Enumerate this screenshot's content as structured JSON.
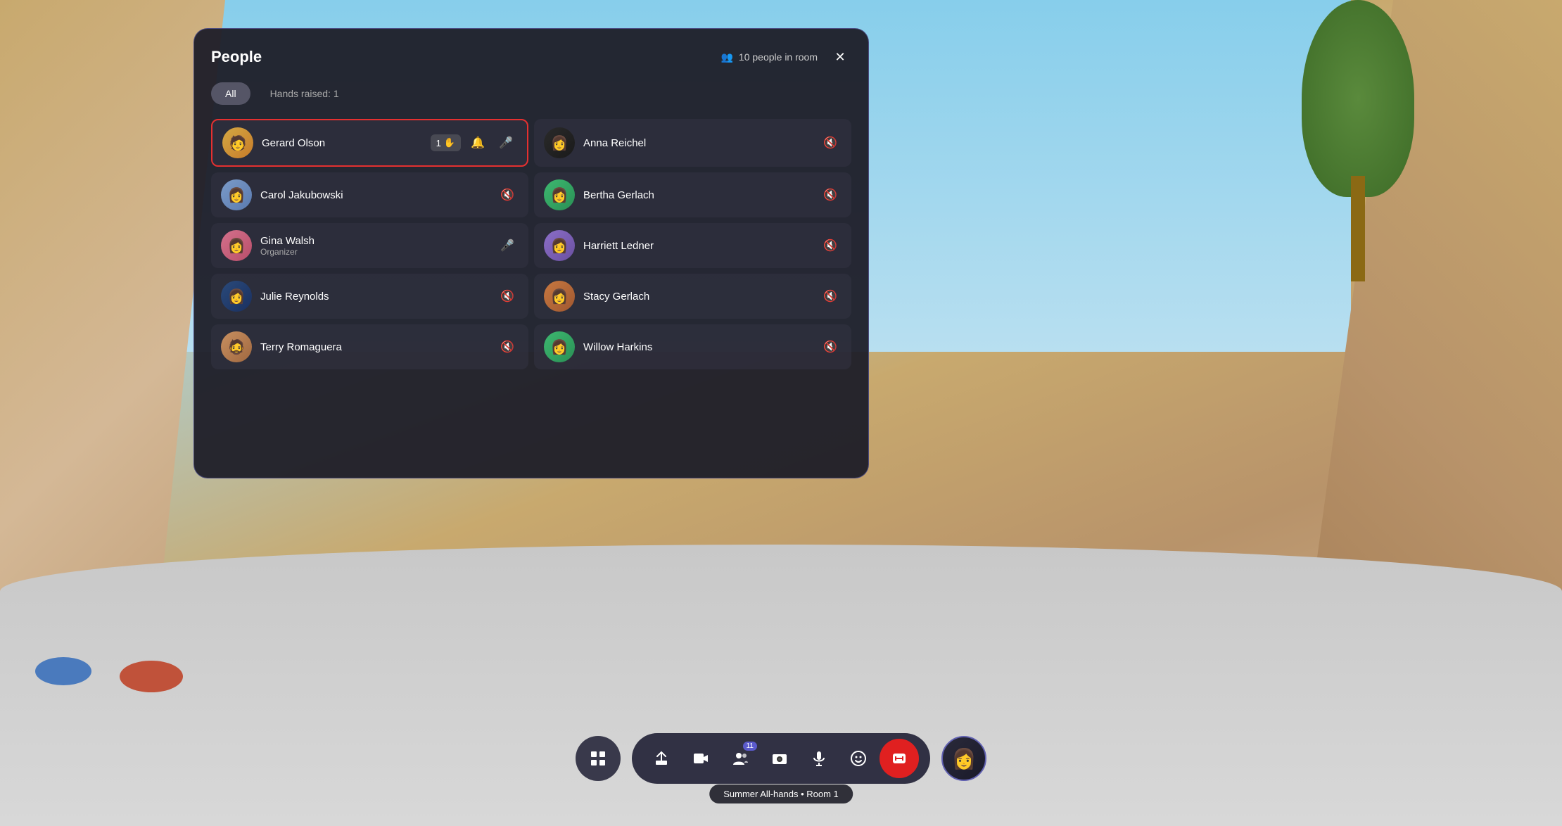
{
  "app": {
    "session_label": "Summer All-hands • Room 1"
  },
  "panel": {
    "title": "People",
    "people_count": "10 people in room",
    "tabs": [
      {
        "id": "all",
        "label": "All",
        "active": true
      },
      {
        "id": "hands",
        "label": "Hands raised: 1",
        "active": false
      }
    ],
    "people": [
      {
        "id": "gerard",
        "name": "Gerard Olson",
        "role": "",
        "hand_raised": true,
        "hand_count": "1",
        "mic_active": true,
        "mic_muted": false,
        "notification": true,
        "avatar_color": "gerard",
        "avatar_emoji": "🧑"
      },
      {
        "id": "anna",
        "name": "Anna Reichel",
        "role": "",
        "hand_raised": false,
        "mic_muted": true,
        "avatar_color": "anna",
        "avatar_emoji": "👩"
      },
      {
        "id": "carol",
        "name": "Carol Jakubowski",
        "role": "",
        "hand_raised": false,
        "mic_muted": true,
        "avatar_color": "carol",
        "avatar_emoji": "👩"
      },
      {
        "id": "bertha",
        "name": "Bertha Gerlach",
        "role": "",
        "hand_raised": false,
        "mic_muted": true,
        "avatar_color": "bertha",
        "avatar_emoji": "👩"
      },
      {
        "id": "gina",
        "name": "Gina Walsh",
        "role": "Organizer",
        "hand_raised": false,
        "mic_active": true,
        "mic_muted": false,
        "avatar_color": "gina",
        "avatar_emoji": "👩"
      },
      {
        "id": "harriett",
        "name": "Harriett Ledner",
        "role": "",
        "hand_raised": false,
        "mic_muted": true,
        "avatar_color": "harriett",
        "avatar_emoji": "👩"
      },
      {
        "id": "julie",
        "name": "Julie Reynolds",
        "role": "",
        "hand_raised": false,
        "mic_muted": true,
        "avatar_color": "julie",
        "avatar_emoji": "👩"
      },
      {
        "id": "stacy",
        "name": "Stacy Gerlach",
        "role": "",
        "hand_raised": false,
        "mic_muted": true,
        "avatar_color": "stacy",
        "avatar_emoji": "👩"
      },
      {
        "id": "terry",
        "name": "Terry Romaguera",
        "role": "",
        "hand_raised": false,
        "mic_muted": true,
        "avatar_color": "terry",
        "avatar_emoji": "🧔"
      },
      {
        "id": "willow",
        "name": "Willow Harkins",
        "role": "",
        "hand_raised": false,
        "mic_muted": true,
        "avatar_color": "willow",
        "avatar_emoji": "👩"
      }
    ]
  },
  "toolbar": {
    "grid_icon": "⊞",
    "share_icon": "↑",
    "video_icon": "🎬",
    "participants_icon": "👤",
    "participants_count": "11",
    "camera_icon": "📷",
    "mic_icon": "🎤",
    "emoji_icon": "😊",
    "end_icon": "📵"
  }
}
